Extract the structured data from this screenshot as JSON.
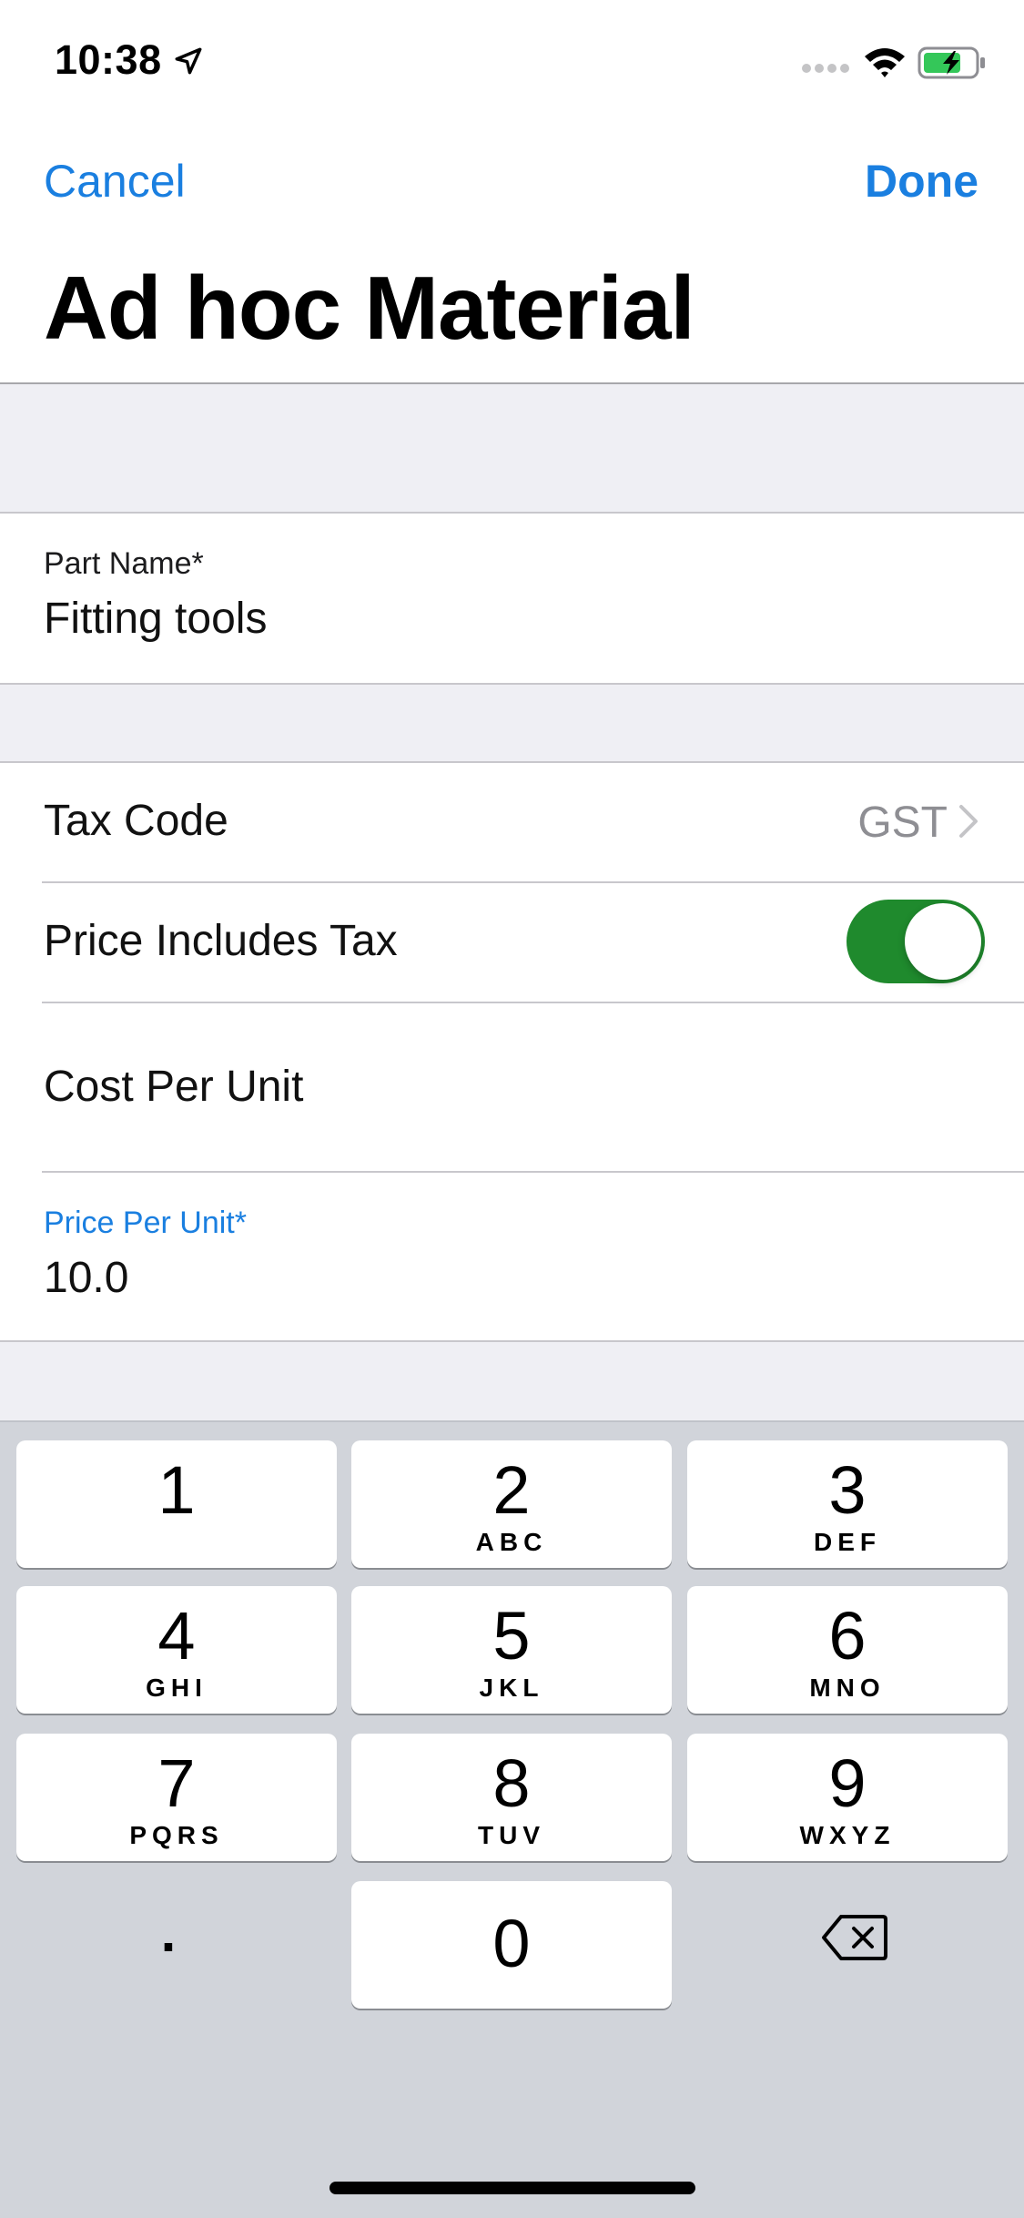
{
  "status_bar": {
    "time": "10:38",
    "icons": [
      "location-arrow-icon",
      "signal-dots-icon",
      "wifi-icon",
      "battery-charging-icon"
    ]
  },
  "nav": {
    "cancel_label": "Cancel",
    "done_label": "Done",
    "title": "Ad hoc Material"
  },
  "form": {
    "part_name": {
      "label": "Part Name*",
      "value": "Fitting tools"
    },
    "tax_code": {
      "label": "Tax Code",
      "value": "GST"
    },
    "price_includes_tax": {
      "label": "Price Includes Tax",
      "on": true
    },
    "cost_per_unit": {
      "label": "Cost Per Unit",
      "value": ""
    },
    "price_per_unit": {
      "label": "Price Per Unit*",
      "value": "10.0"
    }
  },
  "keyboard": {
    "keys": [
      {
        "num": "1",
        "letters": ""
      },
      {
        "num": "2",
        "letters": "ABC"
      },
      {
        "num": "3",
        "letters": "DEF"
      },
      {
        "num": "4",
        "letters": "GHI"
      },
      {
        "num": "5",
        "letters": "JKL"
      },
      {
        "num": "6",
        "letters": "MNO"
      },
      {
        "num": "7",
        "letters": "PQRS"
      },
      {
        "num": "8",
        "letters": "TUV"
      },
      {
        "num": "9",
        "letters": "WXYZ"
      },
      {
        "num": "0",
        "letters": ""
      }
    ],
    "dot_label": "."
  },
  "colors": {
    "accent": "#1a7fe0",
    "toggle_on": "#1f8a2d",
    "group_background": "#efeff4",
    "keyboard_background": "#d1d4da"
  }
}
